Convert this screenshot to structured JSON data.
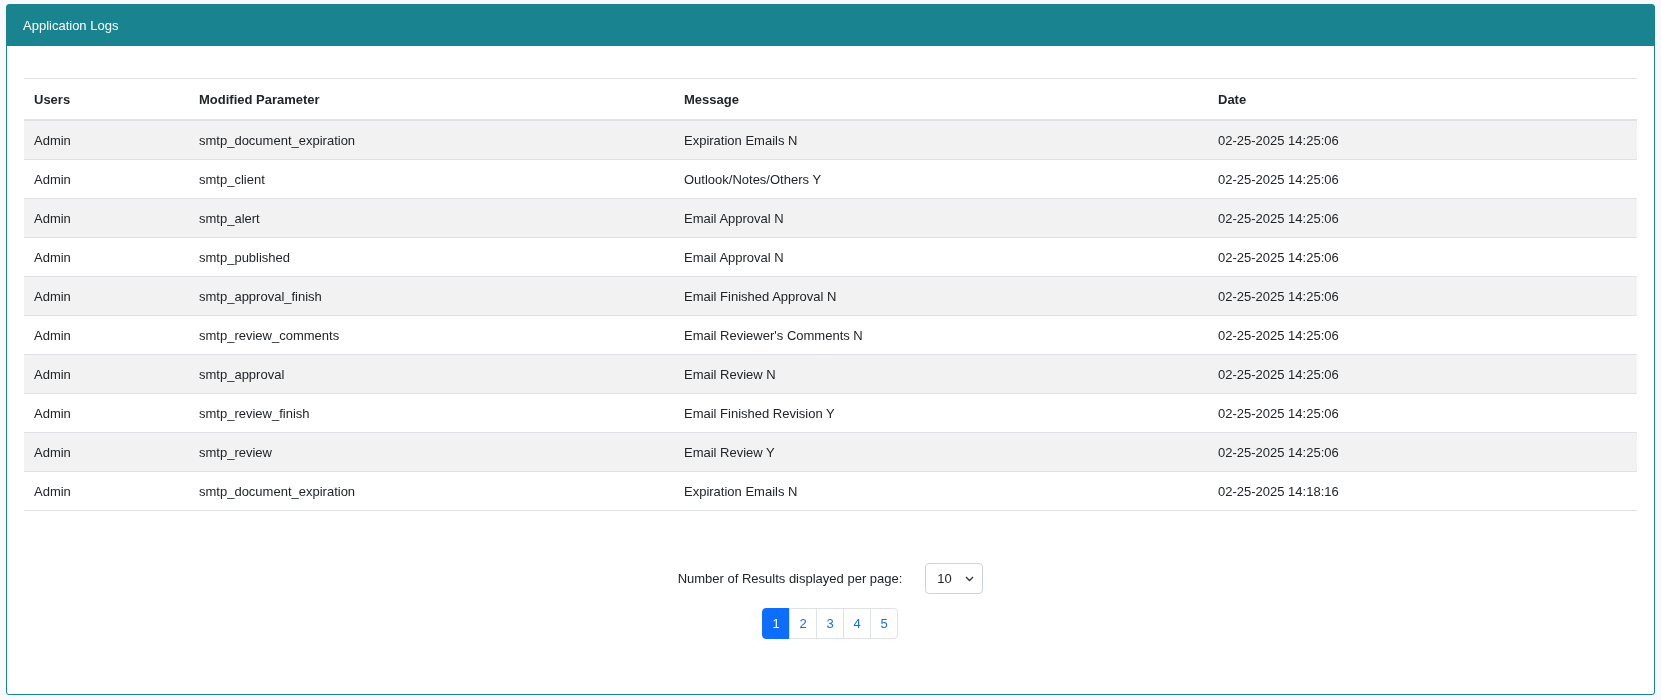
{
  "panel": {
    "title": "Application Logs"
  },
  "table": {
    "columns": [
      "Users",
      "Modified Parameter",
      "Message",
      "Date"
    ],
    "rows": [
      [
        "Admin",
        "smtp_document_expiration",
        "Expiration Emails N",
        "02-25-2025 14:25:06"
      ],
      [
        "Admin",
        "smtp_client",
        "Outlook/Notes/Others Y",
        "02-25-2025 14:25:06"
      ],
      [
        "Admin",
        "smtp_alert",
        "Email Approval N",
        "02-25-2025 14:25:06"
      ],
      [
        "Admin",
        "smtp_published",
        "Email Approval N",
        "02-25-2025 14:25:06"
      ],
      [
        "Admin",
        "smtp_approval_finish",
        "Email Finished Approval N",
        "02-25-2025 14:25:06"
      ],
      [
        "Admin",
        "smtp_review_comments",
        "Email Reviewer's Comments N",
        "02-25-2025 14:25:06"
      ],
      [
        "Admin",
        "smtp_approval",
        "Email Review N",
        "02-25-2025 14:25:06"
      ],
      [
        "Admin",
        "smtp_review_finish",
        "Email Finished Revision Y",
        "02-25-2025 14:25:06"
      ],
      [
        "Admin",
        "smtp_review",
        "Email Review Y",
        "02-25-2025 14:25:06"
      ],
      [
        "Admin",
        "smtp_document_expiration",
        "Expiration Emails N",
        "02-25-2025 14:18:16"
      ]
    ]
  },
  "pagination": {
    "page_size_label": "Number of Results displayed per page:",
    "page_size": "10",
    "pages": [
      {
        "label": "1",
        "selected": true
      },
      {
        "label": "2",
        "selected": false
      },
      {
        "label": "3",
        "selected": false
      },
      {
        "label": "4",
        "selected": false
      },
      {
        "label": "5",
        "selected": false
      }
    ]
  }
}
